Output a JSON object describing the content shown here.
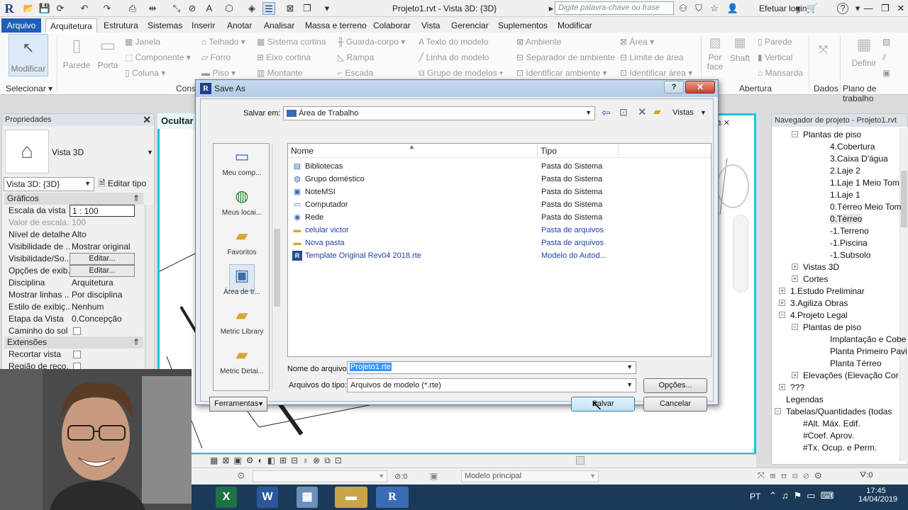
{
  "window": {
    "title": "Projeto1.rvt - Vista 3D: {3D}",
    "search_placeholder": "Digite palavra-chave ou frase",
    "login": "Efetuar login"
  },
  "ribbon_tabs": [
    "Arquivo",
    "Arquitetura",
    "Estrutura",
    "Sistemas",
    "Inserir",
    "Anotar",
    "Analisar",
    "Massa e terreno",
    "Colaborar",
    "Vista",
    "Gerenciar",
    "Suplementos",
    "Modificar"
  ],
  "ribbon": {
    "modify": "Modificar",
    "select": "Selecionar",
    "wall": "Parede",
    "door": "Porta",
    "window": "Janela",
    "component": "Componente",
    "column": "Coluna",
    "build_label": "Cons",
    "roof": "Telhado",
    "ceiling": "Forro",
    "floor": "Piso",
    "curtain_system": "Sistema cortina",
    "curtain_grid": "Eixo cortina",
    "mullion": "Montante",
    "railing": "Guarda-corpo",
    "ramp": "Rampa",
    "stair": "Escada",
    "model_text": "Texto do modelo",
    "model_line": "Linha do modelo",
    "model_group": "Grupo de modelos",
    "room": "Ambiente",
    "room_separator": "Separador de ambiente",
    "tag_room": "Identificar ambiente",
    "area": "Área",
    "area_boundary": "Limite de área",
    "tag_area": "Identificar área",
    "by_face": "Por face",
    "shaft": "Shaft",
    "opening_wall": "Parede",
    "vertical": "Vertical",
    "dormer": "Mansarda",
    "opening_label": "Abertura",
    "datum_label": "Dados",
    "set": "Definir",
    "workplane_label": "Plano de trabalho"
  },
  "properties": {
    "header": "Propriedades",
    "type_name": "Vista 3D",
    "selector": "Vista 3D: {3D}",
    "edit_type": "Editar tipo",
    "section_graphics": "Gráficos",
    "rows": [
      {
        "k": "Escala da vista",
        "v": "1 : 100"
      },
      {
        "k": "Valor de escala...",
        "v": "100"
      },
      {
        "k": "Nível de detalhe",
        "v": "Alto"
      },
      {
        "k": "Visibilidade de ...",
        "v": "Mostrar original"
      },
      {
        "k": "Visibilidade/So...",
        "v": "Editar..."
      },
      {
        "k": "Opções de exib...",
        "v": "Editar..."
      },
      {
        "k": "Disciplina",
        "v": "Arquitetura"
      },
      {
        "k": "Mostrar linhas ...",
        "v": "Por disciplina"
      },
      {
        "k": "Estilo de exibiç...",
        "v": "Nenhum"
      },
      {
        "k": "Etapa da Vista",
        "v": "0.Concepção"
      },
      {
        "k": "Caminho do sol",
        "v": ""
      }
    ],
    "section_extents": "Extensões",
    "ext_rows": [
      {
        "k": "Recortar vista",
        "v": ""
      },
      {
        "k": "Região de reco...",
        "v": ""
      }
    ]
  },
  "view": {
    "tab": "Ocultar"
  },
  "browser": {
    "header": "Navegador de projeto - Projeto1.rvt",
    "items": [
      {
        "label": "Plantas de piso",
        "exp": "−"
      },
      {
        "label": "4.Cobertura",
        "exp": ""
      },
      {
        "label": "3.Caixa D'água",
        "exp": ""
      },
      {
        "label": "2.Laje 2",
        "exp": ""
      },
      {
        "label": "1.Laje 1 Meio Tom",
        "exp": ""
      },
      {
        "label": "1.Laje 1",
        "exp": ""
      },
      {
        "label": "0.Térreo Meio Tom",
        "exp": ""
      },
      {
        "label": "0.Térreo",
        "exp": ""
      },
      {
        "label": "-1.Terreno",
        "exp": ""
      },
      {
        "label": "-1.Piscina",
        "exp": ""
      },
      {
        "label": "-1.Subsolo",
        "exp": ""
      },
      {
        "label": "Vistas 3D",
        "exp": "+"
      },
      {
        "label": "Cortes",
        "exp": "+"
      },
      {
        "label": "1.Estudo Preliminar",
        "exp": "+"
      },
      {
        "label": "3.Agiliza Obras",
        "exp": "+"
      },
      {
        "label": "4.Projeto Legal",
        "exp": "−"
      },
      {
        "label": "Plantas de piso",
        "exp": "−"
      },
      {
        "label": "Implantação e Cobe",
        "exp": ""
      },
      {
        "label": "Planta Primeiro Pavi",
        "exp": ""
      },
      {
        "label": "Planta Térreo",
        "exp": ""
      },
      {
        "label": "Elevações (Elevação Cor",
        "exp": "+"
      },
      {
        "label": "???",
        "exp": "+"
      },
      {
        "label": "Legendas",
        "exp": ""
      },
      {
        "label": "Tabelas/Quantidades (todas",
        "exp": "−"
      },
      {
        "label": "#Alt. Máx. Edif.",
        "exp": ""
      },
      {
        "label": "#Coef. Aprov.",
        "exp": ""
      },
      {
        "label": "#Tx. Ocup. e Perm.",
        "exp": ""
      }
    ]
  },
  "status": {
    "model": "Modelo principal",
    "zero1": ":0",
    "zero2": ":0"
  },
  "taskbar": {
    "lang": "PT",
    "time": "17:45",
    "date": "14/04/2019"
  },
  "dialog": {
    "title": "Save As",
    "save_in_label": "Salvar em:",
    "save_in_value": "Área de Trabalho",
    "views_label": "Vistas",
    "places": [
      "Meu comp...",
      "Meus locai...",
      "Favoritos",
      "Área de tr...",
      "Metric Library",
      "Metric Detai..."
    ],
    "col_name": "Nome",
    "col_type": "Tipo",
    "files": [
      {
        "name": "Bibliotecas",
        "type": "Pasta do Sistema",
        "icon": "▤",
        "blue": false
      },
      {
        "name": "Grupo doméstico",
        "type": "Pasta do Sistema",
        "icon": "◍",
        "blue": false
      },
      {
        "name": "NoteMSI",
        "type": "Pasta do Sistema",
        "icon": "▣",
        "blue": false
      },
      {
        "name": "Computador",
        "type": "Pasta do Sistema",
        "icon": "▭",
        "blue": false
      },
      {
        "name": "Rede",
        "type": "Pasta do Sistema",
        "icon": "◉",
        "blue": false
      },
      {
        "name": "celular victor",
        "type": "Pasta de arquivos",
        "icon": "▬",
        "blue": true
      },
      {
        "name": "Nova pasta",
        "type": "Pasta de arquivos",
        "icon": "▬",
        "blue": true
      },
      {
        "name": "Template Original Rev04 2018.rte",
        "type": "Modelo do Autod...",
        "icon": "R",
        "blue": true
      }
    ],
    "filename_label": "Nome do arquivo:",
    "filename_value": "Projeto1.rte",
    "filetype_label": "Arquivos do tipo:",
    "filetype_value": "Arquivos de modelo  (*.rte)",
    "options_btn": "Opções...",
    "tools_btn": "Ferramentas",
    "save_btn": "Salvar",
    "cancel_btn": "Cancelar"
  },
  "colors": {
    "accent": "#1f5fb5",
    "view_border": "#19c6e0",
    "taskbar": "#1a3a58"
  }
}
